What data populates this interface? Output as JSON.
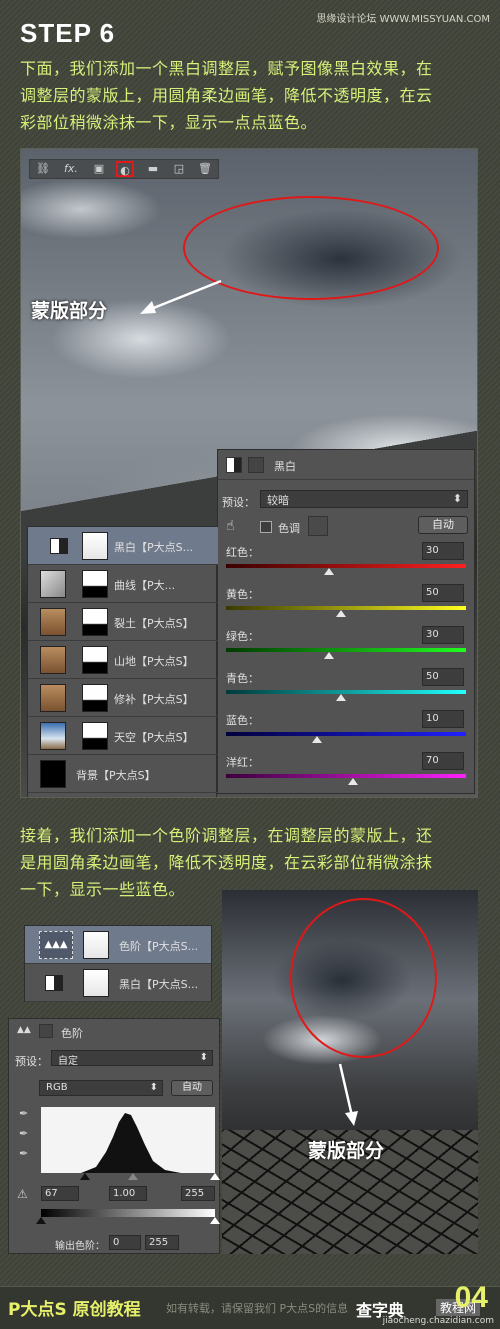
{
  "header": {
    "step": "STEP 6",
    "watermark": "思缘设计论坛 WWW.MISSYUAN.COM"
  },
  "text": {
    "para1": [
      "下面，我们添加一个黑白调整层，赋予图像黑白效果，在",
      "调整层的蒙版上，用圆角柔边画笔，降低不透明度，在云",
      "彩部位稍微涂抹一下，显示一点点蓝色。"
    ],
    "para2": [
      "接着，我们添加一个色阶调整层，在调整层的蒙版上，还",
      "是用圆角柔边画笔，降低不透明度，在云彩部位稍微涂抹",
      "一下，显示一些蓝色。"
    ]
  },
  "toolbar": {
    "icons": [
      "link-icon",
      "fx-icon",
      "mask-icon",
      "adjustment-icon",
      "folder-icon",
      "new-layer-icon",
      "trash-icon"
    ],
    "selected_icon": "adjustment-icon"
  },
  "annotation": {
    "mask_label": "蒙版部分",
    "mask_label2": "蒙版部分"
  },
  "bw_panel": {
    "title": "黑白",
    "preset_label": "预设：",
    "preset_value": "较暗",
    "tint_label": "色调",
    "auto_label": "自动",
    "sliders": [
      {
        "label": "红色：",
        "value": "30",
        "level": 0.43,
        "colors": [
          "#3a0000",
          "#ff2020"
        ]
      },
      {
        "label": "黄色：",
        "value": "50",
        "level": 0.48,
        "colors": [
          "#3a3a00",
          "#ffff20"
        ]
      },
      {
        "label": "绿色：",
        "value": "30",
        "level": 0.43,
        "colors": [
          "#003a00",
          "#20ff20"
        ]
      },
      {
        "label": "青色：",
        "value": "50",
        "level": 0.48,
        "colors": [
          "#003a3a",
          "#20ffff"
        ]
      },
      {
        "label": "蓝色：",
        "value": "10",
        "level": 0.38,
        "colors": [
          "#00003a",
          "#2020ff"
        ]
      },
      {
        "label": "洋红：",
        "value": "70",
        "level": 0.53,
        "colors": [
          "#3a003a",
          "#ff20ff"
        ]
      }
    ]
  },
  "layers": [
    {
      "name": "黑白【P大点S...",
      "type": "adjustment",
      "active": true
    },
    {
      "name": "曲线【P大...",
      "type": "curves",
      "active": false
    },
    {
      "name": "裂土【P大点S】",
      "type": "texture",
      "active": false
    },
    {
      "name": "山地【P大点S】",
      "type": "texture",
      "active": false
    },
    {
      "name": "修补【P大点S】",
      "type": "texture",
      "active": false
    },
    {
      "name": "天空【P大点S】",
      "type": "sky",
      "active": false
    },
    {
      "name": "背景【P大点S】",
      "type": "background",
      "active": false
    }
  ],
  "levels_layers": [
    {
      "name": "色阶【P大点S...",
      "active": true
    },
    {
      "name": "黑白【P大点S...",
      "active": false
    }
  ],
  "levels_panel": {
    "title": "色阶",
    "preset_label": "预设：",
    "preset_value": "自定",
    "channel": "RGB",
    "auto_label": "自动",
    "input_black": "67",
    "input_gamma": "1.00",
    "input_white": "255",
    "output_label": "输出色阶：",
    "output_black": "0",
    "output_white": "255"
  },
  "footer": {
    "brand": "P大点S 原创教程",
    "note": "如有转载，请保留我们 P大点S的信息",
    "site": "查字典",
    "site_tag": "教程网",
    "site_url": "jiaocheng.chazidian.com",
    "page_num": "04"
  }
}
